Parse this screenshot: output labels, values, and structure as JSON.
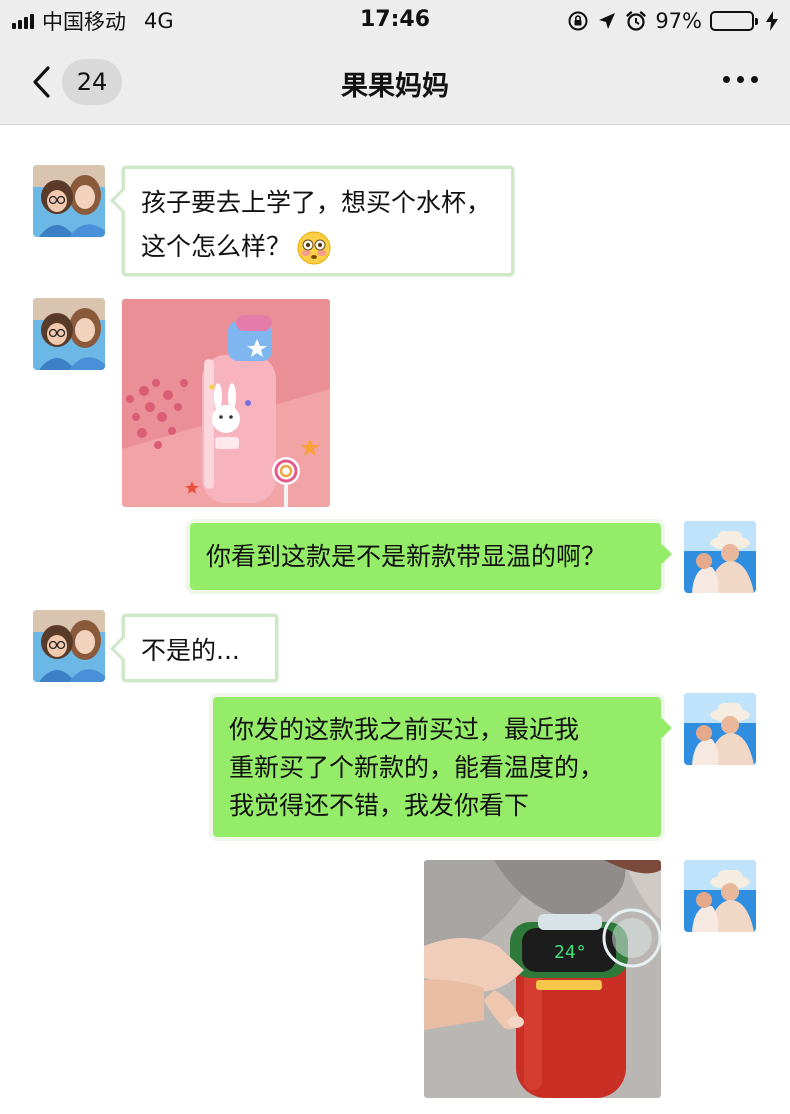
{
  "status_bar": {
    "carrier": "中国移动",
    "network": "4G",
    "time": "17:46",
    "battery_percent": "97%",
    "battery_level": 0.97
  },
  "nav": {
    "back_icon": "chevron-left-icon",
    "unread_count": "24",
    "title": "果果妈妈",
    "more_icon": "ellipsis-icon"
  },
  "colors": {
    "sent_bubble": "#95ec69",
    "received_bubble": "#ffffff",
    "nav_background": "#ededed"
  },
  "messages": [
    {
      "sender": "contact",
      "type": "text",
      "lines": [
        "孩子要去上学了，想买个水杯，",
        "这个怎么样？"
      ],
      "emoji": "flushed-face-emoji"
    },
    {
      "sender": "contact",
      "type": "image",
      "image": "pink-bunny-water-bottle-photo"
    },
    {
      "sender": "me",
      "type": "text",
      "lines": [
        "你看到这款是不是新款带显温的啊？"
      ]
    },
    {
      "sender": "contact",
      "type": "text",
      "lines": [
        "不是的..."
      ]
    },
    {
      "sender": "me",
      "type": "text",
      "lines": [
        "你发的这款我之前买过，最近我",
        "重新买了个新款的，能看温度的，",
        "我觉得还不错，我发你看下"
      ]
    },
    {
      "sender": "me",
      "type": "image",
      "image": "red-temperature-display-bottle-photo",
      "display_reading": "24°"
    }
  ]
}
